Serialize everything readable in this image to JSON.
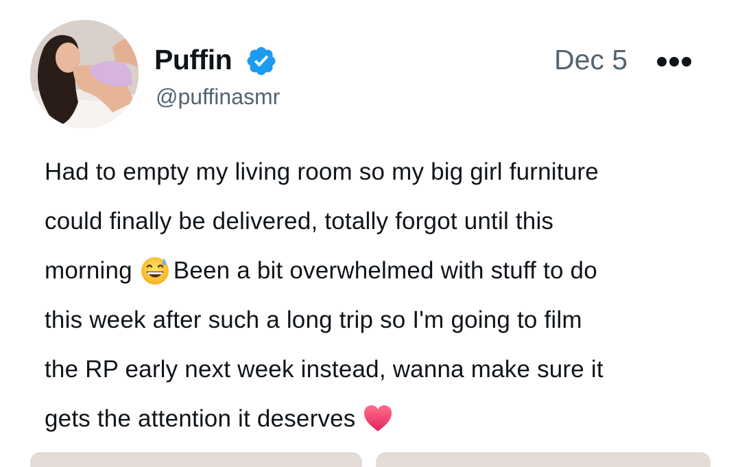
{
  "post": {
    "author": {
      "display_name": "Puffin",
      "handle": "@puffinasmr",
      "verified": true,
      "avatar_icon": "profile-photo"
    },
    "date": "Dec 5",
    "more_icon": "more-horizontal-icon",
    "text_lines": [
      "Had to empty my living room so my big girl furniture",
      "could finally be delivered, totally forgot until this",
      "morning",
      "Been a bit overwhelmed with stuff to do",
      "this week after such a long trip so I'm going to film",
      "the RP early next week instead, wanna make sure it",
      "gets the attention it deserves"
    ],
    "emojis": [
      "grinning-face-with-sweat",
      "red-heart"
    ]
  },
  "colors": {
    "text": "#0f1419",
    "secondary": "#536471",
    "verified": "#1d9bf0",
    "heart": "#e0245e"
  }
}
